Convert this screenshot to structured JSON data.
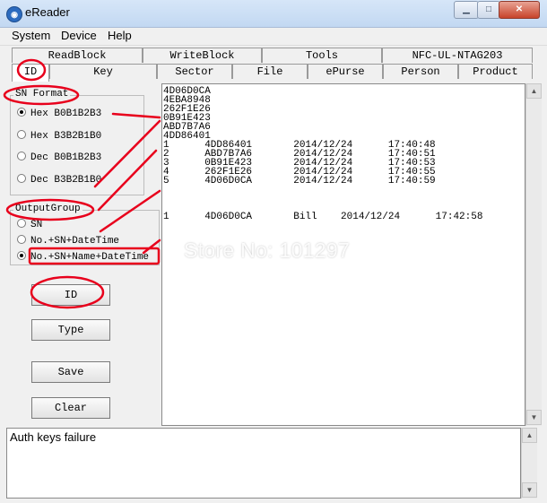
{
  "window": {
    "title": "eReader",
    "icon": "app-logo-icon"
  },
  "menu": [
    "System",
    "Device",
    "Help"
  ],
  "tabs_row1": [
    "ReadBlock",
    "WriteBlock",
    "Tools",
    "NFC-UL-NTAG203"
  ],
  "tabs_row2": [
    "ID",
    "Key",
    "Sector",
    "File",
    "ePurse",
    "Person",
    "Product"
  ],
  "sn_format": {
    "title": "SN Format",
    "options": [
      "Hex B0B1B2B3",
      "Hex B3B2B1B0",
      "Dec B0B1B2B3",
      "Dec B3B2B1B0"
    ],
    "selected": 0
  },
  "output_group": {
    "title": "OutputGroup",
    "options": [
      "SN",
      "No.+SN+DateTime",
      "No.+SN+Name+DateTime"
    ],
    "selected": 2
  },
  "buttons": {
    "id": "ID",
    "type": "Type",
    "save": "Save",
    "clear": "Clear"
  },
  "output_lines": [
    "4D06D0CA",
    "4EBA8948",
    "262F1E26",
    "0B91E423",
    "ABD7B7A6",
    "4DD86401",
    "1      4DD86401       2014/12/24      17:40:48",
    "2      ABD7B7A6       2014/12/24      17:40:51",
    "3      0B91E423       2014/12/24      17:40:53",
    "4      262F1E26       2014/12/24      17:40:55",
    "5      4D06D0CA       2014/12/24      17:40:59",
    "",
    "",
    "",
    "1      4D06D0CA       Bill    2014/12/24      17:42:58"
  ],
  "status": {
    "message": "Auth keys failure"
  },
  "watermark": "Store No: 101297",
  "colors": {
    "annotation": "#e8001c",
    "titlebar": "#c8dcf3"
  }
}
